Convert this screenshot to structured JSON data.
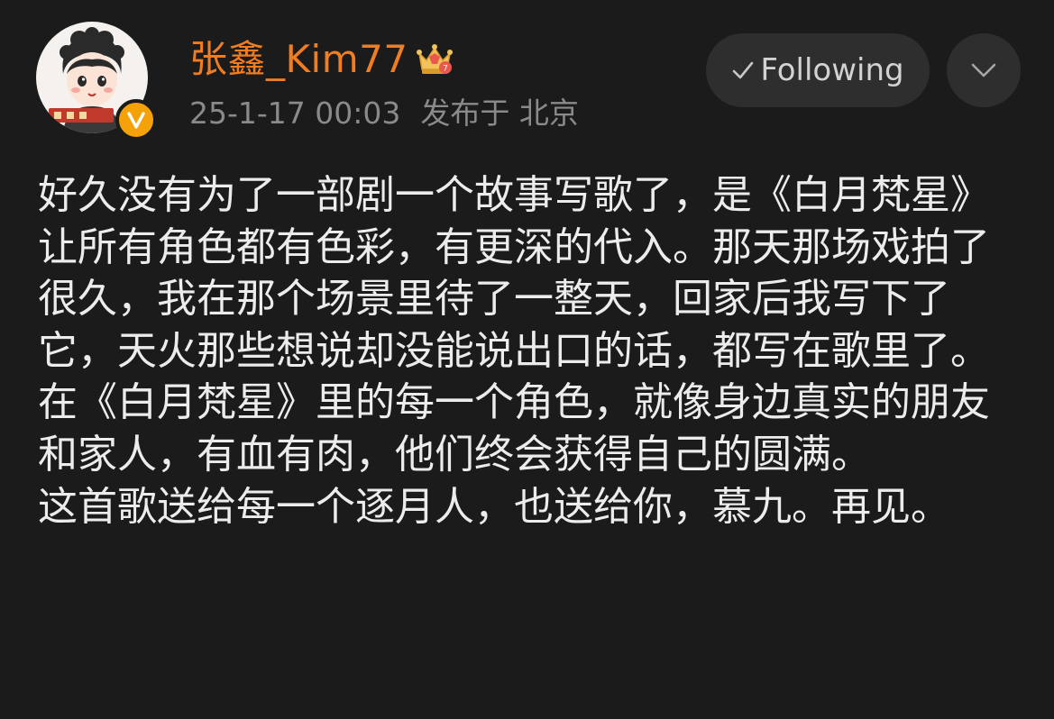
{
  "post": {
    "author": {
      "name": "张鑫_Kim77",
      "avatar_icon": "avatar-illustration",
      "badge_icon": "verified-v-icon",
      "level_icon": "crown-icon"
    },
    "meta": {
      "timestamp": "25-1-17 00:03",
      "location": "发布于 北京"
    },
    "actions": {
      "follow_label": "Following",
      "more_icon": "chevron-down-icon"
    },
    "content": {
      "text": "好久没有为了一部剧一个故事写歌了，是《白月梵星》让所有角色都有色彩，有更深的代入。那天那场戏拍了很久，我在那个场景里待了一整天，回家后我写下了它，天火那些想说却没能说出口的话，都写在歌里了。\n在《白月梵星》里的每一个角色，就像身边真实的朋友和家人，有血有肉，他们终会获得自己的圆满。\n这首歌送给每一个逐月人，也送给你，慕九。再见。"
    }
  },
  "colors": {
    "background": "#1b1b1b",
    "username": "#f07d22",
    "meta_text": "#8a8a8a",
    "button_bg": "#2e2e2e",
    "badge": "#f5a20a"
  }
}
